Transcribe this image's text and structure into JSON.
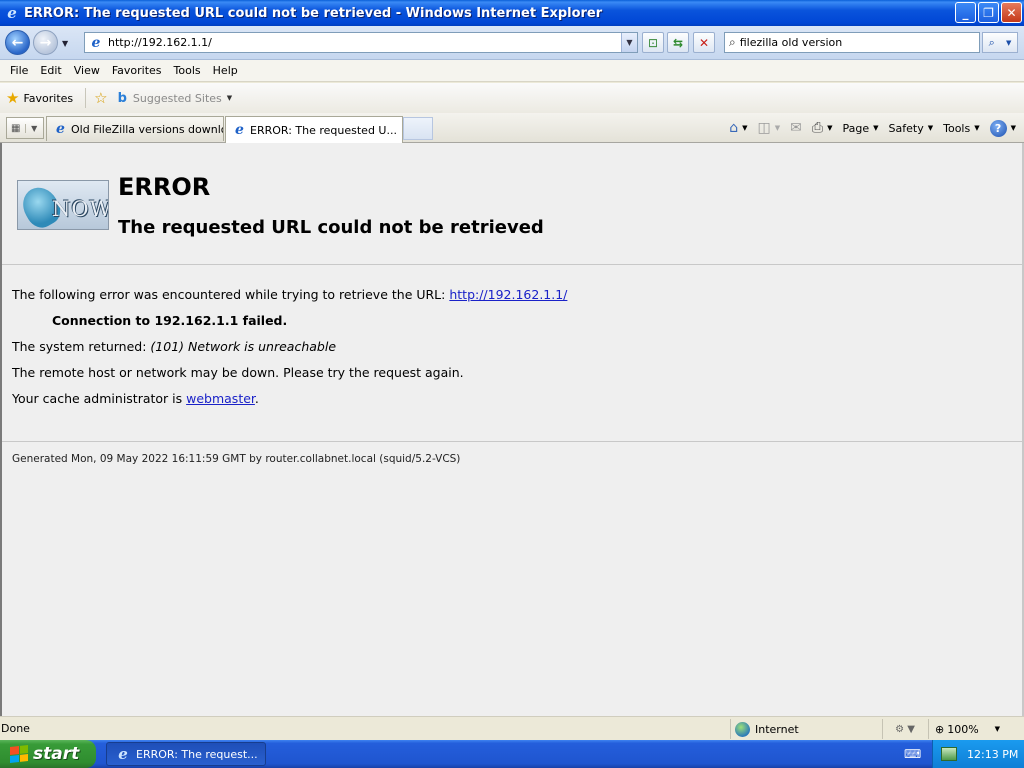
{
  "window": {
    "title": "ERROR: The requested URL could not be retrieved - Windows Internet Explorer",
    "minimize": "_",
    "maximize": "❐",
    "close": "✕"
  },
  "address": {
    "url": "http://192.162.1.1/",
    "search_value": "filezilla old version"
  },
  "menu": [
    "File",
    "Edit",
    "View",
    "Favorites",
    "Tools",
    "Help"
  ],
  "favorites_bar": {
    "favorites_label": "Favorites",
    "suggested_sites": "Suggested Sites"
  },
  "tabs": [
    {
      "label": "Old FileZilla versions download"
    },
    {
      "label": "ERROR: The requested U..."
    }
  ],
  "command_bar": {
    "page": "Page",
    "safety": "Safety",
    "tools": "Tools"
  },
  "page": {
    "error_title": "ERROR",
    "error_subtitle": "The requested URL could not be retrieved",
    "logo_text": "NOW",
    "line1_prefix": "The following error was encountered while trying to retrieve the URL: ",
    "line1_link": "http://192.162.1.1/",
    "line2": "Connection to 192.162.1.1 failed.",
    "line3_prefix": "The system returned: ",
    "line3_italic": "(101) Network is unreachable",
    "line4": "The remote host or network may be down. Please try the request again.",
    "line5_prefix": "Your cache administrator is ",
    "line5_link": "webmaster",
    "line5_suffix": ".",
    "footer": "Generated Mon, 09 May 2022 16:11:59 GMT by router.collabnet.local (squid/5.2-VCS)"
  },
  "status": {
    "text": "Done",
    "zone": "Internet",
    "zoom": "100%"
  },
  "taskbar": {
    "start": "start",
    "item": "ERROR: The request...",
    "clock": "12:13 PM"
  }
}
